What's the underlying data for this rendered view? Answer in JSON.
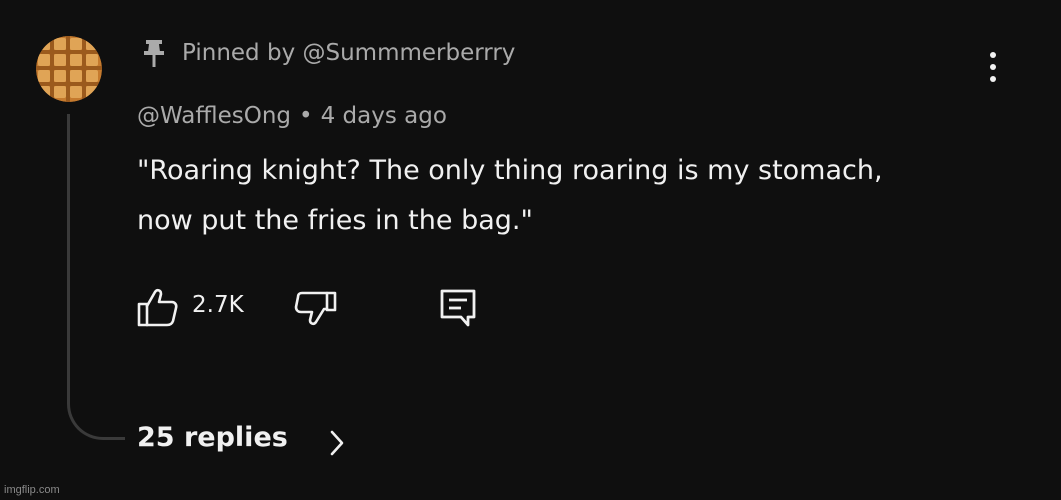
{
  "comment": {
    "pinned_text": "Pinned by @Summmerberrry",
    "author": "@WafflesOng",
    "separator": "•",
    "time": "4 days ago",
    "text": "\"Roaring knight? The only thing roaring is my stomach, now put the fries in the bag.\"",
    "like_count": "2.7K",
    "replies_label": "25 replies"
  },
  "icons": {
    "avatar": "waffle-avatar",
    "pin": "pin-icon",
    "menu": "more-vert-icon",
    "like": "thumb-up-icon",
    "dislike": "thumb-down-icon",
    "reply": "comment-reply-icon",
    "chevron": "chevron-right-icon"
  },
  "watermark": "imgflip.com",
  "colors": {
    "background": "#0f0f0f",
    "primary_text": "#f1f1f1",
    "secondary_text": "#aaaaaa",
    "avatar_waffle": "#d0893a"
  }
}
